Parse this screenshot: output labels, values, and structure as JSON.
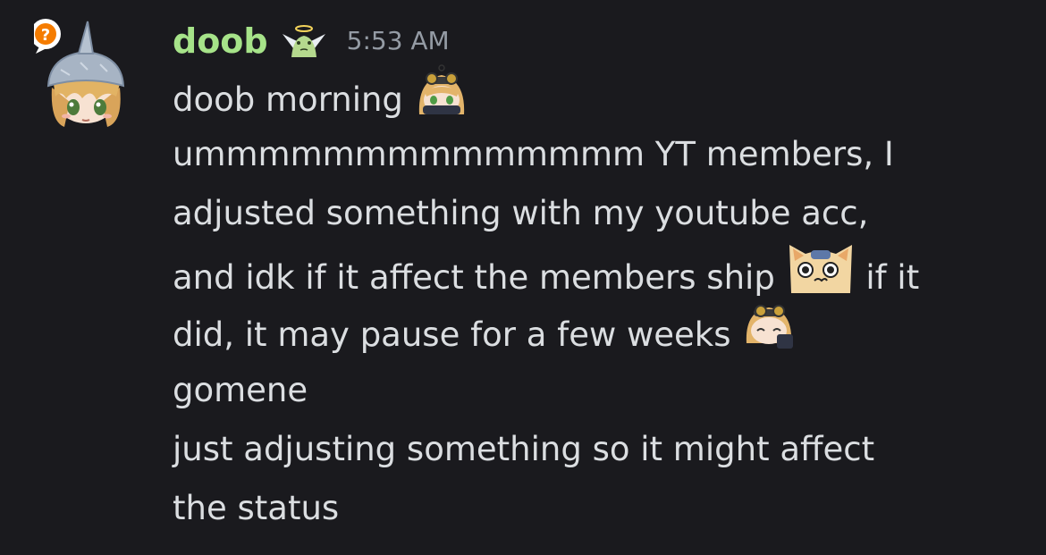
{
  "message": {
    "author": "doob",
    "author_color": "#a6e389",
    "timestamp": "5:53 AM",
    "avatar_badge_icon": "question-mark-icon",
    "role_icon": "winged-frog-icon",
    "lines": [
      "doob morning",
      "ummmmmmmmmmmmmm YT members, I",
      "adjusted something with my youtube acc,",
      "and idk if it affect the members ship",
      "if it",
      "did, it may pause for a few weeks",
      "gomene",
      "just adjusting something so it might affect",
      "the status"
    ],
    "emojis": {
      "morning": "peeking-girl-emoji",
      "ship": "sad-cat-emoji",
      "weeks": "sleepy-girl-emoji"
    }
  },
  "colors": {
    "background": "#1a1a1e",
    "text": "#dbdee1",
    "timestamp": "#949ba4",
    "badge": "#f57c00"
  }
}
